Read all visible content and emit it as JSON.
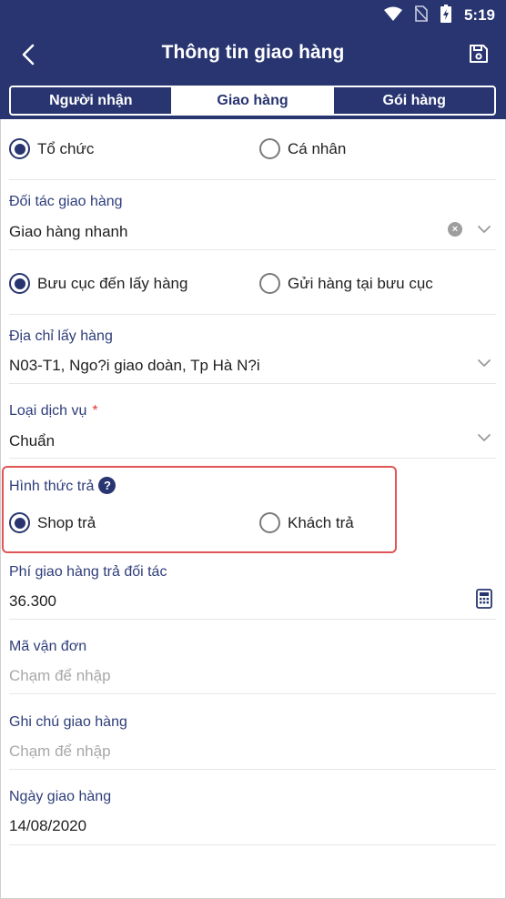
{
  "status": {
    "time": "5:19"
  },
  "header": {
    "title": "Thông tin giao hàng"
  },
  "tabs": [
    {
      "label": "Người nhận",
      "active": false
    },
    {
      "label": "Giao hàng",
      "active": true
    },
    {
      "label": "Gói hàng",
      "active": false
    }
  ],
  "customer_type": {
    "options": [
      {
        "label": "Tổ chức",
        "checked": true
      },
      {
        "label": "Cá nhân",
        "checked": false
      }
    ]
  },
  "partner": {
    "label": "Đối tác giao hàng",
    "value": "Giao hàng nhanh"
  },
  "pickup_method": {
    "options": [
      {
        "label": "Bưu cục đến lấy hàng",
        "checked": true
      },
      {
        "label": "Gửi hàng tại bưu cục",
        "checked": false
      }
    ]
  },
  "pickup_address": {
    "label": "Địa chỉ lấy hàng",
    "value": "N03-T1, Ngo?i giao doàn, Tp Hà N?i"
  },
  "service_type": {
    "label": "Loại dịch vụ",
    "required_mark": "*",
    "value": "Chuẩn"
  },
  "payment_method": {
    "label": "Hình thức trả",
    "help": "?",
    "options": [
      {
        "label": "Shop trả",
        "checked": true
      },
      {
        "label": "Khách trả",
        "checked": false
      }
    ]
  },
  "partner_fee": {
    "label": "Phí giao hàng trả đối tác",
    "value": "36.300"
  },
  "tracking_code": {
    "label": "Mã vận đơn",
    "placeholder": "Chạm để nhập"
  },
  "delivery_note": {
    "label": "Ghi chú giao hàng",
    "placeholder": "Chạm để nhập"
  },
  "delivery_date": {
    "label": "Ngày giao hàng",
    "value": "14/08/2020"
  },
  "colors": {
    "primary": "#283570",
    "highlight": "#e05555",
    "required": "#e53935"
  }
}
